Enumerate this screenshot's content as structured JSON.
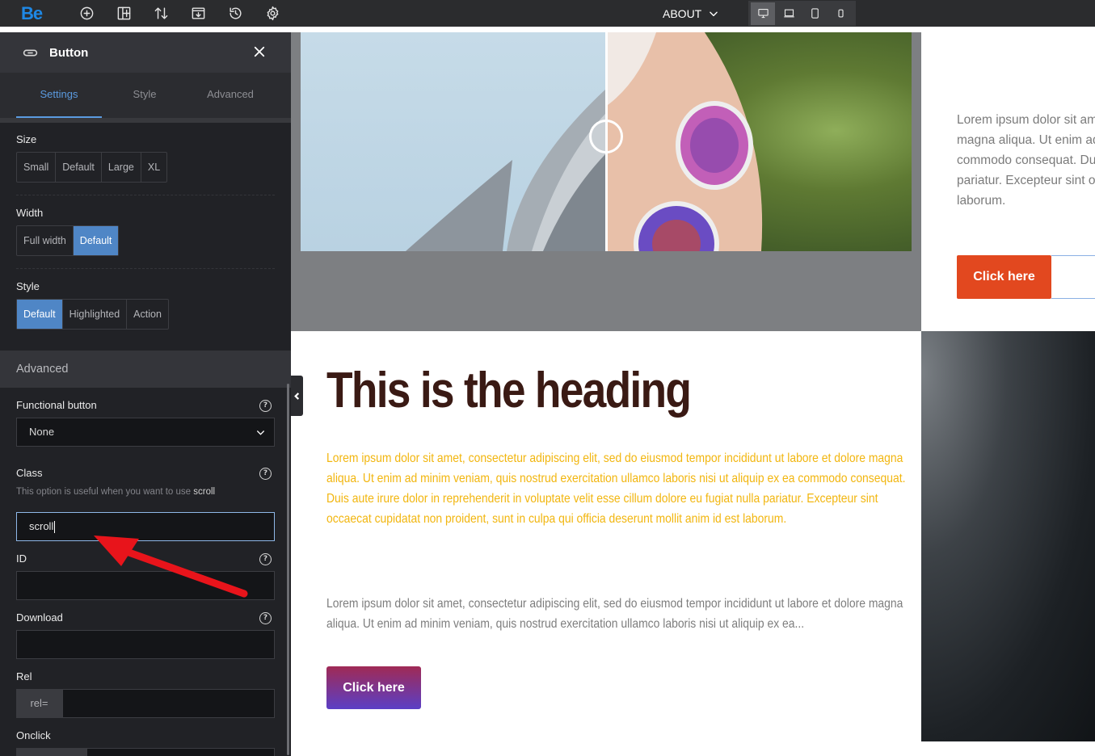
{
  "topbar": {
    "logo": "Be",
    "page_label": "ABOUT",
    "icons": [
      "add-icon",
      "layout-icon",
      "sort-icon",
      "export-icon",
      "history-icon",
      "gear-icon"
    ],
    "devices": [
      "desktop-icon",
      "laptop-icon",
      "tablet-icon",
      "mobile-icon"
    ]
  },
  "sidebar": {
    "title": "Button",
    "tabs": [
      "Settings",
      "Style",
      "Advanced"
    ],
    "size": {
      "label": "Size",
      "options": [
        "Small",
        "Default",
        "Large",
        "XL"
      ]
    },
    "width": {
      "label": "Width",
      "options": [
        "Full width",
        "Default"
      ],
      "selected": "Default"
    },
    "style": {
      "label": "Style",
      "options": [
        "Default",
        "Highlighted",
        "Action"
      ],
      "selected": "Default"
    },
    "advanced": {
      "heading": "Advanced",
      "functional_button": {
        "label": "Functional button",
        "value": "None"
      },
      "class": {
        "label": "Class",
        "hint": "This option is useful when you want to use",
        "hint_bold": "scroll",
        "value": "scroll"
      },
      "id": {
        "label": "ID",
        "value": ""
      },
      "download": {
        "label": "Download",
        "value": ""
      },
      "rel": {
        "label": "Rel",
        "prefix": "rel=",
        "value": ""
      },
      "onclick": {
        "label": "Onclick"
      }
    },
    "help_glyph": "?"
  },
  "canvas": {
    "top_right_text": [
      "Lorem ipsum dolor sit amet,",
      "magna aliqua. Ut enim ad",
      "commodo consequat. Duis",
      "pariatur. Excepteur sint oc",
      "laborum."
    ],
    "top_button": "Click here",
    "heading": "This is the heading",
    "paragraph_yellow": "Lorem ipsum dolor sit amet, consectetur adipiscing elit, sed do eiusmod tempor incididunt ut labore et dolore magna aliqua. Ut enim ad minim veniam, quis nostrud exercitation ullamco laboris nisi ut aliquip ex ea commodo consequat. Duis aute irure dolor in reprehenderit in voluptate velit esse cillum dolore eu fugiat nulla pariatur. Excepteur sint occaecat cupidatat non proident, sunt in culpa qui officia deserunt mollit anim id est laborum.",
    "paragraph_gray": "Lorem ipsum dolor sit amet, consectetur adipiscing elit, sed do eiusmod tempor incididunt ut labore et dolore magna aliqua. Ut enim ad minim veniam, quis nostrud exercitation ullamco laboris nisi ut aliquip ex ea...",
    "bottom_button": "Click here"
  },
  "colors": {
    "accent": "#4f86c6",
    "orange_button": "#e2481f",
    "heading": "#3a1a14",
    "yellow_text": "#f2b60f",
    "annotation_arrow": "#e8141b"
  }
}
